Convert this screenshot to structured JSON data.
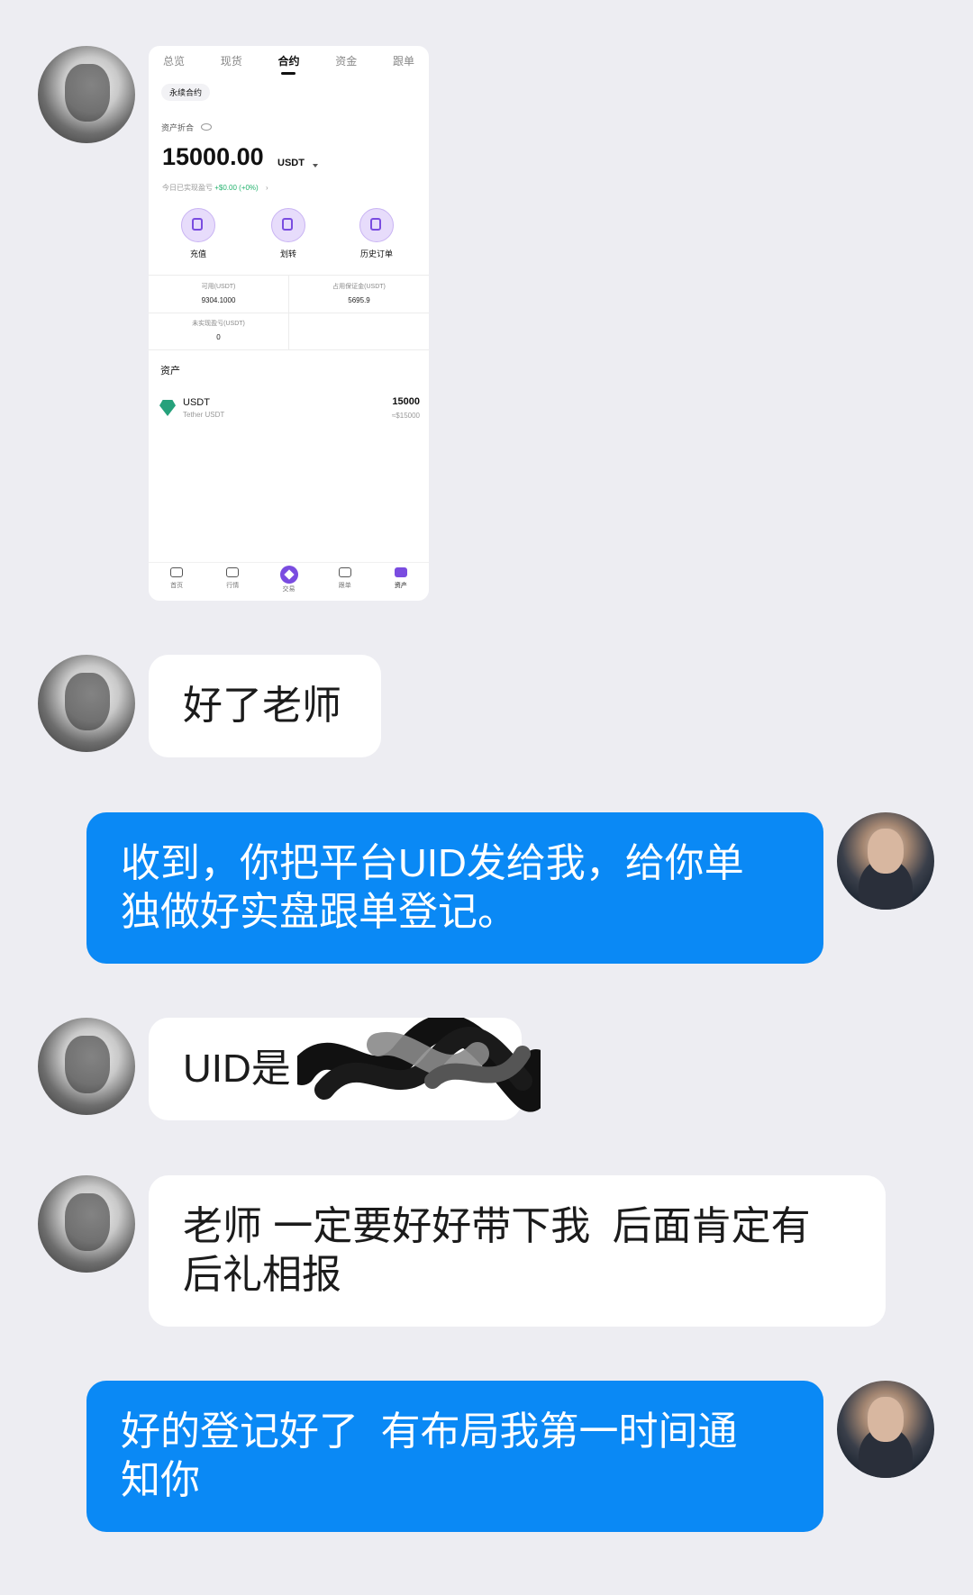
{
  "screenshot": {
    "tabs": [
      {
        "label": "总览",
        "active": false
      },
      {
        "label": "现货",
        "active": false
      },
      {
        "label": "合约",
        "active": true
      },
      {
        "label": "资金",
        "active": false
      },
      {
        "label": "跟单",
        "active": false
      }
    ],
    "chip_label": "永续合约",
    "asset_label": "资产折合",
    "balance": "15000.00",
    "balance_unit": "USDT",
    "pnl_label": "今日已实现盈亏",
    "pnl_value": "+$0.00 (+0%)",
    "pnl_arrow": "›",
    "actions": [
      {
        "label": "充值",
        "icon": "download-icon"
      },
      {
        "label": "划转",
        "icon": "transfer-icon"
      },
      {
        "label": "历史订单",
        "icon": "document-icon"
      }
    ],
    "stats": [
      {
        "label": "可用(USDT)",
        "value": "9304.1000"
      },
      {
        "label": "占用保证金(USDT)",
        "value": "5695.9"
      },
      {
        "label": "未实现盈亏(USDT)",
        "value": "0"
      }
    ],
    "section_title": "资产",
    "asset_row": {
      "name": "USDT",
      "full_name": "Tether USDT",
      "amount": "15000",
      "usd_value": "≈$15000"
    },
    "bottom_nav": [
      {
        "label": "首页",
        "active": false
      },
      {
        "label": "行情",
        "active": false
      },
      {
        "label": "交易",
        "active": false
      },
      {
        "label": "跟单",
        "active": false
      },
      {
        "label": "资产",
        "active": true
      }
    ]
  },
  "messages": [
    {
      "side": "left",
      "type": "image"
    },
    {
      "side": "left",
      "type": "text",
      "text": "好了老师"
    },
    {
      "side": "right",
      "type": "text",
      "text": "收到，你把平台UID发给我，给你单\n独做好实盘跟单登记。"
    },
    {
      "side": "left",
      "type": "text",
      "text": "UID是"
    },
    {
      "side": "left",
      "type": "text",
      "text": "老师 一定要好好带下我  后面肯定有\n后礼相报"
    },
    {
      "side": "right",
      "type": "text",
      "text": "好的登记好了  有布局我第一时间通\n知你"
    }
  ],
  "colors": {
    "background": "#ededf2",
    "bubble_out": "#0a89f5",
    "bubble_in": "#ffffff",
    "accent_purple": "#7a4ce0",
    "pnl_green": "#23b26d"
  }
}
